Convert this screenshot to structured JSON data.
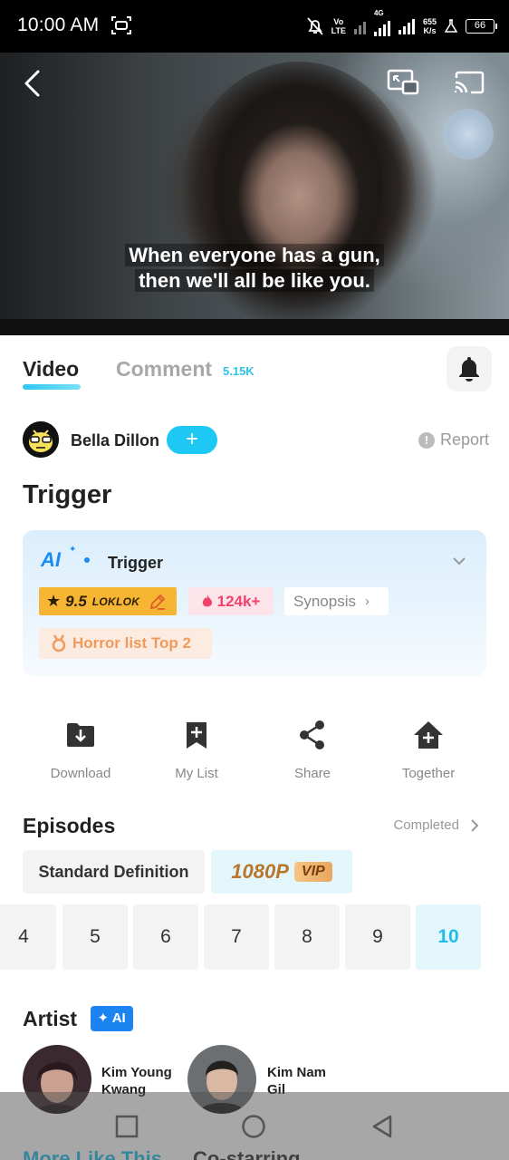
{
  "status_bar": {
    "time": "10:00 AM",
    "network_speed_value": "655",
    "network_speed_unit": "K/s",
    "network_type": "4G",
    "volte_top": "Vo",
    "volte_bottom": "LTE",
    "battery": "66"
  },
  "video": {
    "subtitle_line1": "When everyone has a gun,",
    "subtitle_line2": "then we'll all be like you."
  },
  "tabs": {
    "video_label": "Video",
    "comment_label": "Comment",
    "comment_count": "5.15K"
  },
  "uploader": {
    "name": "Bella Dillon",
    "follow_label": "+",
    "report_label": "Report"
  },
  "title": "Trigger",
  "ai_card": {
    "logo": "AI",
    "title": "Trigger",
    "rating": "9.5",
    "rating_brand": "LOKLOK",
    "heat": "124k+",
    "synopsis_label": "Synopsis",
    "rank_label": "Horror list Top 2"
  },
  "actions": [
    {
      "label": "Download",
      "icon": "download-folder-icon"
    },
    {
      "label": "My List",
      "icon": "bookmark-add-icon"
    },
    {
      "label": "Share",
      "icon": "share-icon"
    },
    {
      "label": "Together",
      "icon": "home-add-icon"
    }
  ],
  "episodes": {
    "title": "Episodes",
    "status": "Completed",
    "definition_standard": "Standard Definition",
    "definition_hd": "1080P",
    "vip_label": "VIP",
    "items": [
      "4",
      "5",
      "6",
      "7",
      "8",
      "9",
      "10"
    ],
    "active": "10"
  },
  "artist": {
    "title": "Artist",
    "ai_badge": "AI",
    "people": [
      {
        "name_line1": "Kim Young",
        "name_line2": "Kwang"
      },
      {
        "name_line1": "Kim Nam",
        "name_line2": "Gil"
      }
    ]
  },
  "bottom_tabs": {
    "first": "More Like This",
    "second": "Co-starring"
  },
  "colors": {
    "accent": "#21bde8",
    "rating_bg": "#f6b533",
    "heat": "#f0426d",
    "rank": "#f29a5c",
    "ai_blue": "#1a8cf5"
  }
}
